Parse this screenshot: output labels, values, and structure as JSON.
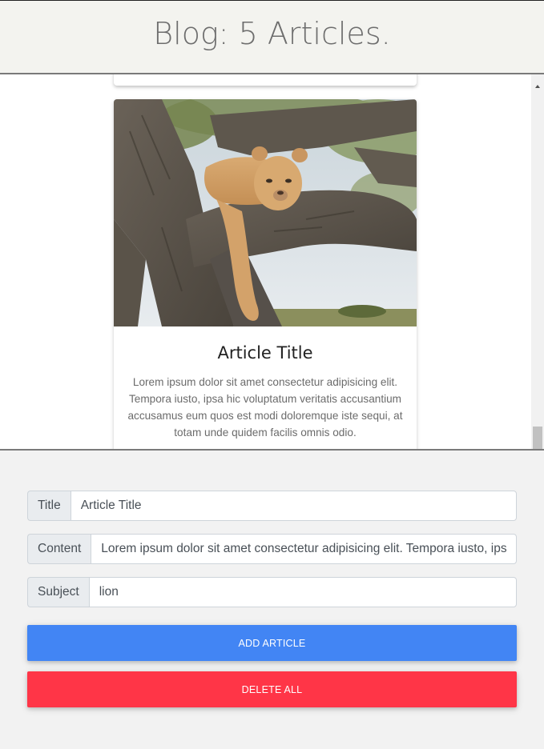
{
  "header": {
    "title": "Blog: 5 Articles."
  },
  "article": {
    "image_subject": "lion resting in tree",
    "title": "Article Title",
    "content": "Lorem ipsum dolor sit amet consectetur adipisicing elit. Tempora iusto, ipsa hic voluptatum veritatis accusantium accusamus eum quos est modi doloremque iste sequi, at totam unde quidem facilis omnis odio."
  },
  "form": {
    "title_label": "Title",
    "title_value": "Article Title",
    "content_label": "Content",
    "content_value": "Lorem ipsum dolor sit amet consectetur adipisicing elit. Tempora iusto, ipsa hic voluptatum veritatis accusantium accusamus eum quos est modi doloremque iste sequi, at totam unde quidem facilis omnis odio.",
    "subject_label": "Subject",
    "subject_value": "lion",
    "add_button": "Add Article",
    "delete_button": "Delete All"
  },
  "colors": {
    "add_button": "#4285f4",
    "delete_button": "#ff3547"
  }
}
